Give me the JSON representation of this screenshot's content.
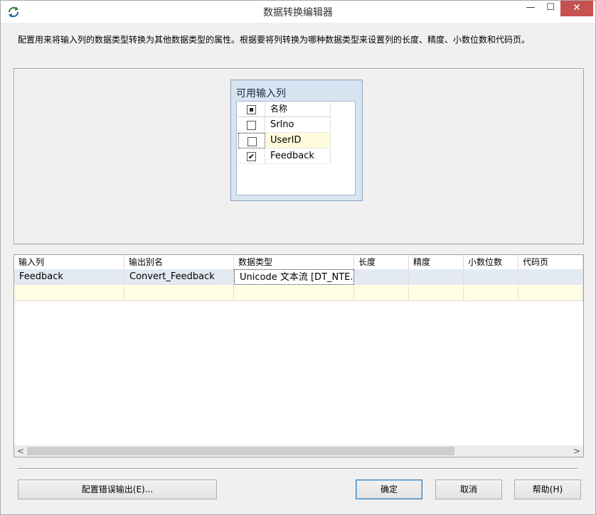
{
  "window": {
    "title": "数据转换编辑器",
    "close_glyph": "✕",
    "minimize_glyph": "—",
    "maximize_glyph": "☐",
    "icon": "data-conversion-icon"
  },
  "description": "配置用来将输入列的数据类型转换为其他数据类型的属性。根据要将列转换为哪种数据类型来设置列的长度、精度、小数位数和代码页。",
  "available_columns": {
    "title": "可用输入列",
    "header": {
      "name_label": "名称",
      "checkbox_state": "partial"
    },
    "items": [
      {
        "name": "Srlno",
        "checked": false,
        "check_glyph": ""
      },
      {
        "name": "UserID",
        "checked": false,
        "check_glyph": ""
      },
      {
        "name": "Feedback",
        "checked": true,
        "check_glyph": "✔"
      }
    ]
  },
  "grid": {
    "columns": [
      "输入列",
      "输出别名",
      "数据类型",
      "长度",
      "精度",
      "小数位数",
      "代码页"
    ],
    "rows": [
      {
        "input_column": "Feedback",
        "output_alias": "Convert_Feedback",
        "data_type": "Unicode 文本流 [DT_NTE...",
        "length": "",
        "precision": "",
        "scale": "",
        "code_page": ""
      }
    ],
    "scroll_left": "<",
    "scroll_right": ">"
  },
  "buttons": {
    "configure_error_output": "配置错误输出(E)...",
    "ok": "确定",
    "cancel": "取消",
    "help": "帮助(H)"
  },
  "colors": {
    "selected_row": "#e4eaf2",
    "new_row": "#fffde2",
    "panel_header": "#d7e4f2",
    "close_button": "#c75050"
  }
}
